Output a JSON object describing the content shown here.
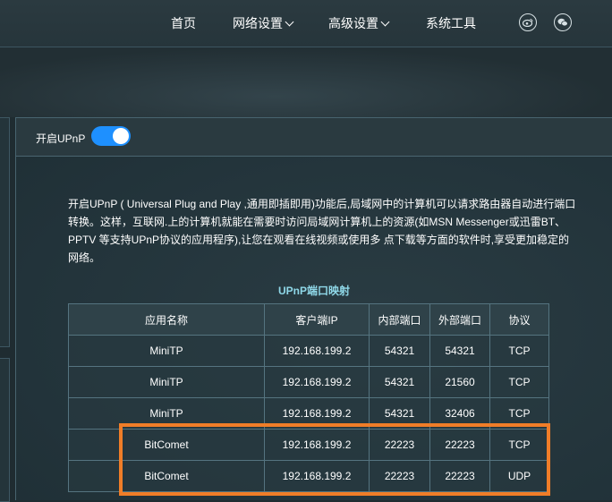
{
  "nav": {
    "home": "首页",
    "network": "网络设置",
    "advanced": "高级设置",
    "tools": "系统工具"
  },
  "icons": {
    "weibo": "weibo-icon",
    "wechat": "wechat-icon"
  },
  "upnp": {
    "label": "开启UPnP",
    "enabled": true,
    "description": "开启UPnP ( Universal Plug and Play ,通用即插即用)功能后,局域网中的计算机可以请求路由器自动进行端口转换。这样，互联网.上的计算机就能在需要时访问局域网计算机上的资源(如MSN Messenger或迅雷BT、PPTV 等支持UPnP协议的应用程序),让您在观看在线视频或使用多 点下载等方面的软件时,享受更加稳定的网络。"
  },
  "table": {
    "title": "UPnP端口映射",
    "headers": [
      "应用名称",
      "客户端IP",
      "内部端口",
      "外部端口",
      "协议"
    ],
    "rows": [
      [
        "MiniTP",
        "192.168.199.2",
        "54321",
        "54321",
        "TCP"
      ],
      [
        "MiniTP",
        "192.168.199.2",
        "54321",
        "21560",
        "TCP"
      ],
      [
        "MiniTP",
        "192.168.199.2",
        "54321",
        "32406",
        "TCP"
      ],
      [
        "BitComet",
        "192.168.199.2",
        "22223",
        "22223",
        "TCP"
      ],
      [
        "BitComet",
        "192.168.199.2",
        "22223",
        "22223",
        "UDP"
      ]
    ]
  },
  "colors": {
    "accent": "#1e90ff",
    "highlight": "#f07d28",
    "title": "#8fd8e8"
  }
}
